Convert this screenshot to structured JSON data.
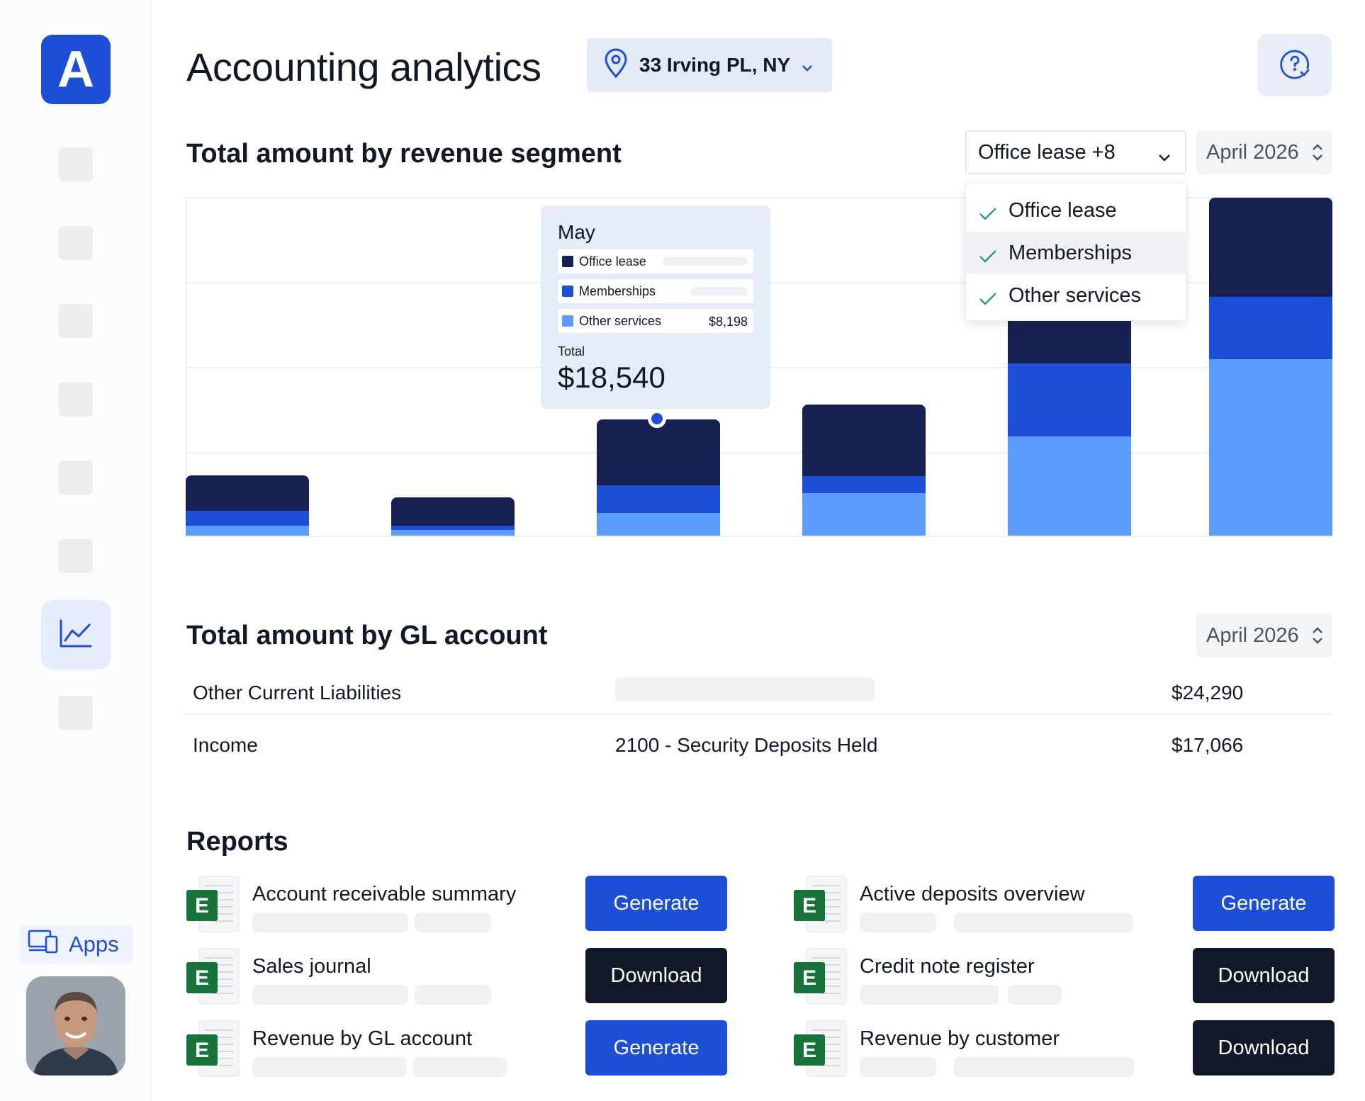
{
  "app": {
    "logo_letter": "A",
    "title": "Accounting analytics"
  },
  "location": {
    "label": "33 Irving PL, NY"
  },
  "sidebar": {
    "apps_label": "Apps"
  },
  "revenue": {
    "heading": "Total amount by revenue segment",
    "segment_select": "Office lease +8",
    "date_select": "April 2026",
    "dropdown": [
      "Office lease",
      "Memberships",
      "Other services"
    ],
    "tooltip": {
      "month": "May",
      "rows": [
        {
          "label": "Office lease",
          "value": ""
        },
        {
          "label": "Memberships",
          "value": ""
        },
        {
          "label": "Other services",
          "value": "$8,198"
        }
      ],
      "total_label": "Total",
      "total": "$18,540"
    }
  },
  "colors": {
    "office_lease": "#172052",
    "memberships": "#1d4ed8",
    "other_services": "#5b9dff",
    "accent": "#1d4ed8"
  },
  "chart_data": {
    "type": "bar",
    "stacked": true,
    "categories": [
      "",
      "",
      "May",
      "",
      "",
      ""
    ],
    "series": [
      {
        "name": "Office lease",
        "values": [
          42,
          33,
          78,
          85,
          185,
          117
        ]
      },
      {
        "name": "Memberships",
        "values": [
          17,
          5,
          32,
          20,
          86,
          74
        ]
      },
      {
        "name": "Other services",
        "values": [
          12,
          7,
          27,
          50,
          117,
          208
        ]
      }
    ],
    "ylim": [
      0,
      400
    ],
    "grid": true,
    "xlabel": "",
    "ylabel": ""
  },
  "gl": {
    "heading": "Total amount by GL account",
    "date_select": "April 2026",
    "rows": [
      {
        "type": "Other Current Liabilities",
        "account": "",
        "amount": "$24,290"
      },
      {
        "type": "Income",
        "account": "2100 - Security Deposits Held",
        "amount": "$17,066"
      }
    ]
  },
  "reports": {
    "heading": "Reports",
    "file_letter": "E",
    "items": [
      {
        "name": "Account receivable summary",
        "action": "Generate"
      },
      {
        "name": "Active deposits overview",
        "action": "Generate"
      },
      {
        "name": "Sales journal",
        "action": "Download"
      },
      {
        "name": "Credit note register",
        "action": "Download"
      },
      {
        "name": "Revenue by GL account",
        "action": "Generate"
      },
      {
        "name": "Revenue by customer",
        "action": "Download"
      }
    ]
  }
}
